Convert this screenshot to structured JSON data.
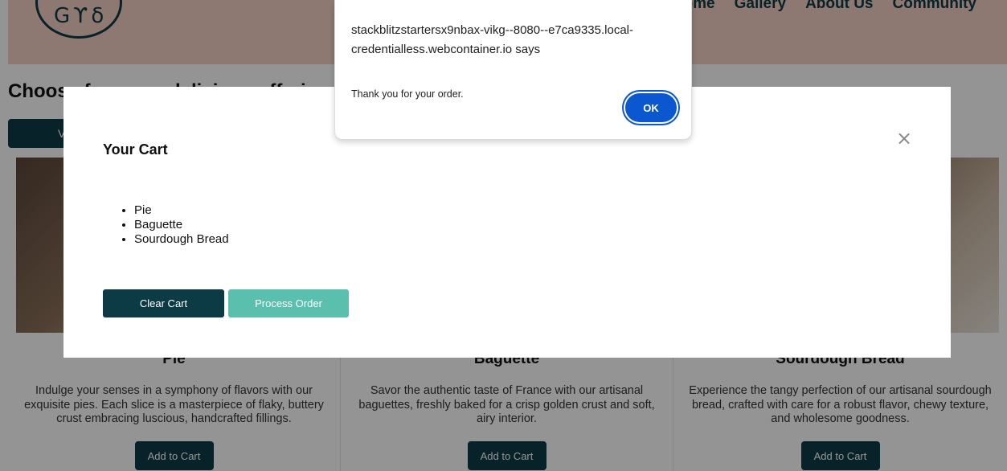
{
  "header": {
    "logo_glyph": "Gϒδ",
    "nav": [
      "Home",
      "Gallery",
      "About Us",
      "Community"
    ]
  },
  "page": {
    "title": "Choose from our delicious offerings",
    "view_tab": "V"
  },
  "products": [
    {
      "title": "Pie",
      "description": "Indulge your senses in a symphony of flavors with our exquisite pies. Each slice is a masterpiece of flaky, buttery crust embracing luscious, handcrafted fillings.",
      "button": "Add to Cart"
    },
    {
      "title": "Baguette",
      "description": "Savor the authentic taste of France with our artisanal baguettes, freshly baked for a crisp golden crust and soft, airy interior.",
      "button": "Add to Cart"
    },
    {
      "title": "Sourdough Bread",
      "description": "Experience the tangy perfection of our artisanal sourdough bread, crafted with care for a robust flavor, chewy texture, and wholesome goodness.",
      "button": "Add to Cart"
    }
  ],
  "cart_modal": {
    "title": "Your Cart",
    "close_symbol": "×",
    "items": [
      "Pie",
      "Baguette",
      "Sourdough Bread"
    ],
    "clear_button": "Clear Cart",
    "process_button": "Process Order"
  },
  "alert": {
    "origin": "stackblitzstartersx9nbax-vikg--8080--e7ca9335.local-credentialless.webcontainer.io says",
    "message": "Thank you for your order.",
    "ok_button": "OK"
  },
  "colors": {
    "header_bg": "#f4cfc4",
    "primary_dark": "#0d3b45",
    "accent_teal": "#5bbfad",
    "alert_blue": "#0b57d0"
  }
}
